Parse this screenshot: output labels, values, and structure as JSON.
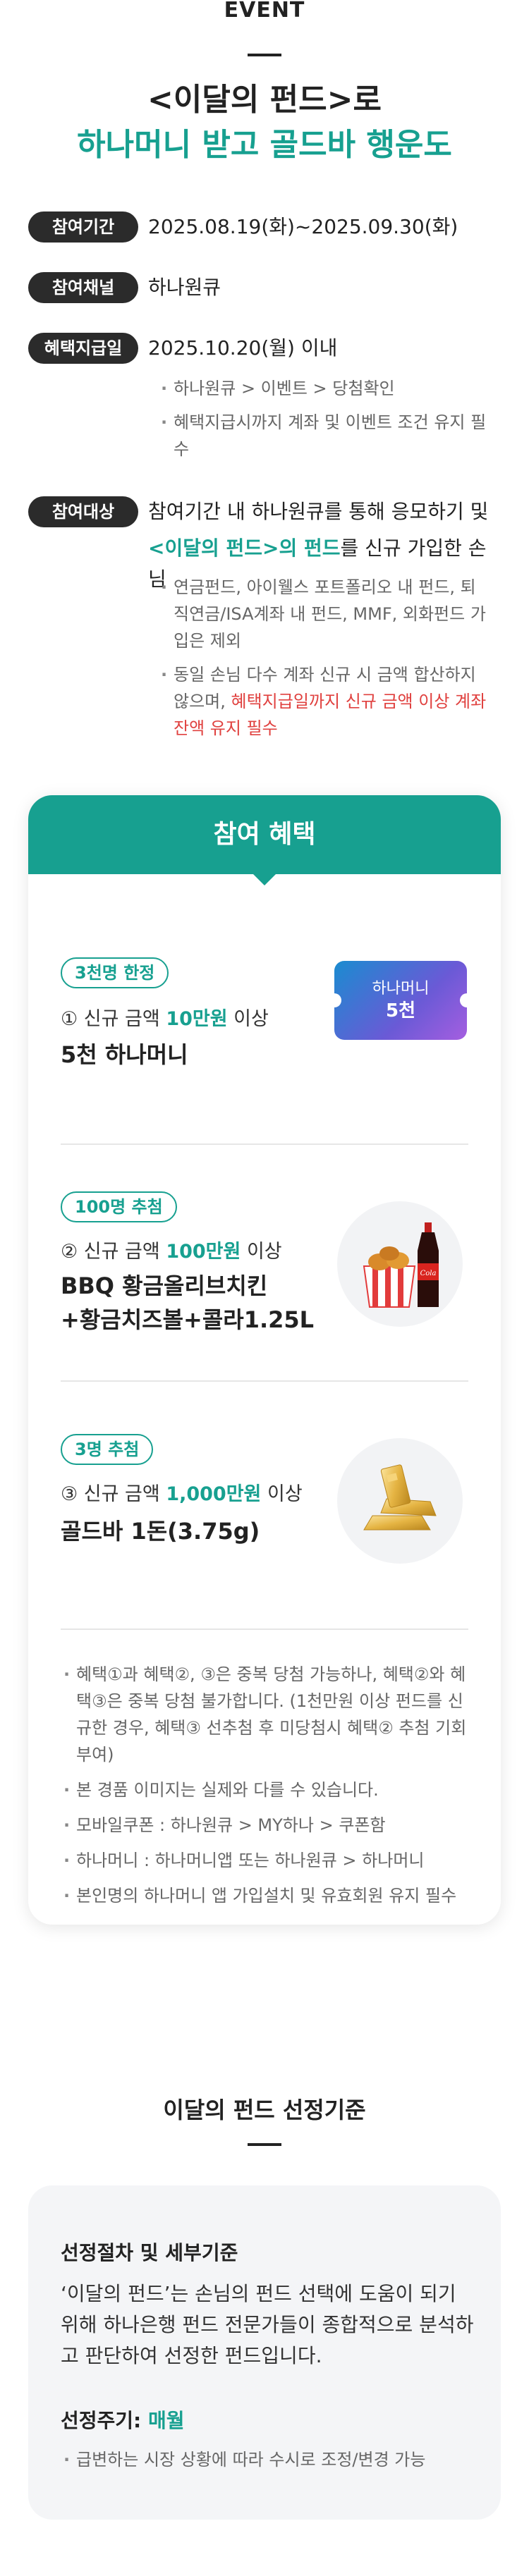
{
  "header": {
    "event_label": "EVENT",
    "title_line1": "<이달의 펀드>로",
    "title_line2": "하나머니 받고 골드바 행운도"
  },
  "info": {
    "period": {
      "label": "참여기간",
      "value": "2025.08.19(화)~2025.09.30(화)"
    },
    "channel": {
      "label": "참여채널",
      "value": "하나원큐"
    },
    "payment": {
      "label": "혜택지급일",
      "value": "2025.10.20(월) 이내",
      "notes": [
        "하나원큐 > 이벤트 > 당첨확인",
        "혜택지급시까지 계좌 및 이벤트 조건 유지 필수"
      ]
    },
    "target": {
      "label": "참여대상",
      "line1": "참여기간 내 하나원큐를 통해 응모하기 및",
      "line2_highlight": "<이달의 펀드>의 펀드",
      "line2_rest": "를 신규 가입한 손님",
      "note1": "연금펀드, 아이웰스 포트폴리오 내 펀드, 퇴직연금/ISA계좌 내 펀드, MMF, 외화펀드 가입은 제외",
      "note2_plain": "동일 손님 다수 계좌 신규 시 금액 합산하지 않으며, ",
      "note2_red": "혜택지급일까지 신규 금액 이상 계좌 잔액 유지 필수"
    }
  },
  "benefits": {
    "title": "참여 혜택",
    "items": [
      {
        "tag": "3천명 한정",
        "cond_prefix": "① 신규 금액 ",
        "cond_amount": "10만원",
        "cond_suffix": " 이상",
        "prize_line1": "5천 하나머니",
        "prize_line2": "",
        "coupon_line1": "하나머니",
        "coupon_line2": "5천"
      },
      {
        "tag": "100명 추첨",
        "cond_prefix": "② 신규 금액 ",
        "cond_amount": "100만원",
        "cond_suffix": " 이상",
        "prize_line1": "BBQ 황금올리브치킨",
        "prize_line2": "+황금치즈볼+콜라1.25L"
      },
      {
        "tag": "3명 추첨",
        "cond_prefix": "③ 신규 금액 ",
        "cond_amount": "1,000만원",
        "cond_suffix": " 이상",
        "prize_line1": "골드바 1돈(3.75g)",
        "prize_line2": ""
      }
    ],
    "notes": [
      "혜택①과 혜택②, ③은 중복 당첨 가능하나, 혜택②와 혜택③은 중복 당첨 불가합니다. (1천만원 이상 펀드를 신규한 경우, 혜택③ 선추첨 후 미당첨시 혜택② 추첨 기회부여)",
      "본 경품 이미지는 실제와 다를 수 있습니다.",
      "모바일쿠폰 : 하나원큐 > MY하나 > 쿠폰함",
      "하나머니 : 하나머니앱 또는 하나원큐 > 하나머니",
      "본인명의 하나머니 앱 가입설치 및 유효회원 유지 필수"
    ]
  },
  "criteria": {
    "title": "이달의 펀드 선정기준",
    "heading": "선정절차 및 세부기준",
    "body": "‘이달의 펀드’는 손님의 펀드 선택에 도움이 되기 위해 하나은행 펀드 전문가들이 종합적으로 분석하고 판단하여 선정한 펀드입니다.",
    "cycle_label": "선정주기: ",
    "cycle_value": "매월",
    "cycle_note": "급변하는 시장 상황에 따라 수시로 조정/변경 가능"
  },
  "colors": {
    "accent": "#17a090",
    "dark_pill": "#2b2b2b",
    "alert": "#e0413f"
  }
}
